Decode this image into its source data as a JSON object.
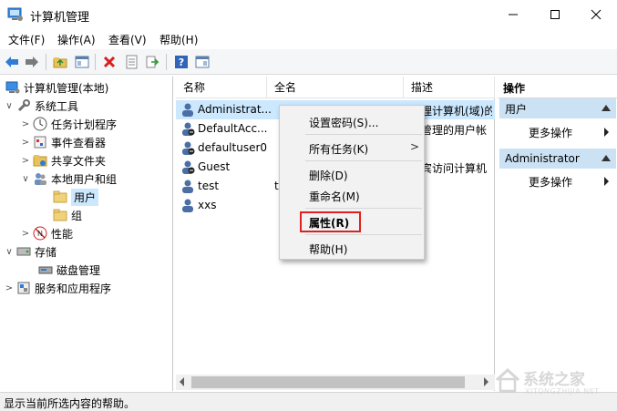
{
  "window": {
    "title": "计算机管理"
  },
  "menubar": [
    {
      "label": "文件(F)"
    },
    {
      "label": "操作(A)"
    },
    {
      "label": "查看(V)"
    },
    {
      "label": "帮助(H)"
    }
  ],
  "toolbar": {
    "icons": [
      "back-arrow-icon",
      "forward-arrow-icon",
      "up-folder-icon",
      "show-hide-tree-icon",
      "delete-icon",
      "properties-icon",
      "export-icon",
      "help-icon",
      "show-hide-action-pane-icon"
    ]
  },
  "tree": [
    {
      "label": "计算机管理(本地)"
    },
    {
      "label": "系统工具"
    },
    {
      "label": "任务计划程序"
    },
    {
      "label": "事件查看器"
    },
    {
      "label": "共享文件夹"
    },
    {
      "label": "本地用户和组"
    },
    {
      "label": "用户"
    },
    {
      "label": "组"
    },
    {
      "label": "性能"
    },
    {
      "label": "存储"
    },
    {
      "label": "磁盘管理"
    },
    {
      "label": "服务和应用程序"
    }
  ],
  "list": {
    "columns": [
      "名称",
      "全名",
      "描述"
    ],
    "rows": [
      {
        "name": "Administrat...",
        "fullname": "",
        "desc": "管理计算机(域)的"
      },
      {
        "name": "DefaultAcc...",
        "fullname": "",
        "desc": "统管理的用户帐"
      },
      {
        "name": "defaultuser0",
        "fullname": "",
        "desc": ""
      },
      {
        "name": "Guest",
        "fullname": "",
        "desc": "来宾访问计算机"
      },
      {
        "name": "test",
        "fullname": "t",
        "desc": ""
      },
      {
        "name": "xxs",
        "fullname": "",
        "desc": ""
      }
    ]
  },
  "context_menu": {
    "items": [
      {
        "label": "设置密码(S)..."
      },
      {
        "label": "所有任务(K)",
        "submenu_arrow": ">"
      },
      {
        "label": "删除(D)"
      },
      {
        "label": "重命名(M)"
      },
      {
        "label": "属性(R)"
      },
      {
        "label": "帮助(H)"
      }
    ],
    "highlight_color": "#e02020"
  },
  "actions": {
    "header": "操作",
    "sections": [
      {
        "title": "用户",
        "more": "更多操作"
      },
      {
        "title": "Administrator",
        "more": "更多操作"
      }
    ]
  },
  "status": {
    "text": "显示当前所选内容的帮助。"
  },
  "watermark": {
    "text": "系统之家",
    "sub": "XITONGZHIJIA.NET"
  },
  "colors": {
    "selection": "#cce8ff",
    "action_section": "#cbe2f5",
    "accent_blue": "#1e6fd0"
  }
}
